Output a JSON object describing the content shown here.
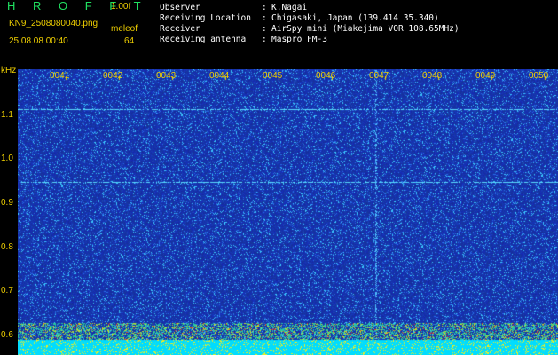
{
  "header": {
    "app_title": "H R O F F T",
    "version": "1.00f",
    "filename": "KN9_2508080040.png",
    "site_tag": "meleof",
    "timestamp": "25.08.08 00:40",
    "count": "64"
  },
  "info": [
    {
      "label": "Observer",
      "value": "K.Nagai"
    },
    {
      "label": "Receiving Location",
      "value": "Chigasaki, Japan (139.414 35.340)"
    },
    {
      "label": "Receiver",
      "value": "AirSpy mini (Miakejima VOR 108.65MHz)"
    },
    {
      "label": "Receiving antenna",
      "value": "Maspro FM-3"
    }
  ],
  "axis": {
    "y_unit": "kHz",
    "y_labels": [
      "1.1",
      "1.0",
      "0.9",
      "0.8",
      "0.7",
      "0.6"
    ],
    "x_labels": [
      "0041",
      "0042",
      "0043",
      "0044",
      "0045",
      "0046",
      "0047",
      "0048",
      "0049",
      "0050"
    ]
  },
  "colors": {
    "background": "#000000",
    "text_yellow": "#f0d000",
    "title_green": "#20e060",
    "spectrogram_base": "#1a30a0",
    "baseline_cyan": "#00e0ff"
  }
}
